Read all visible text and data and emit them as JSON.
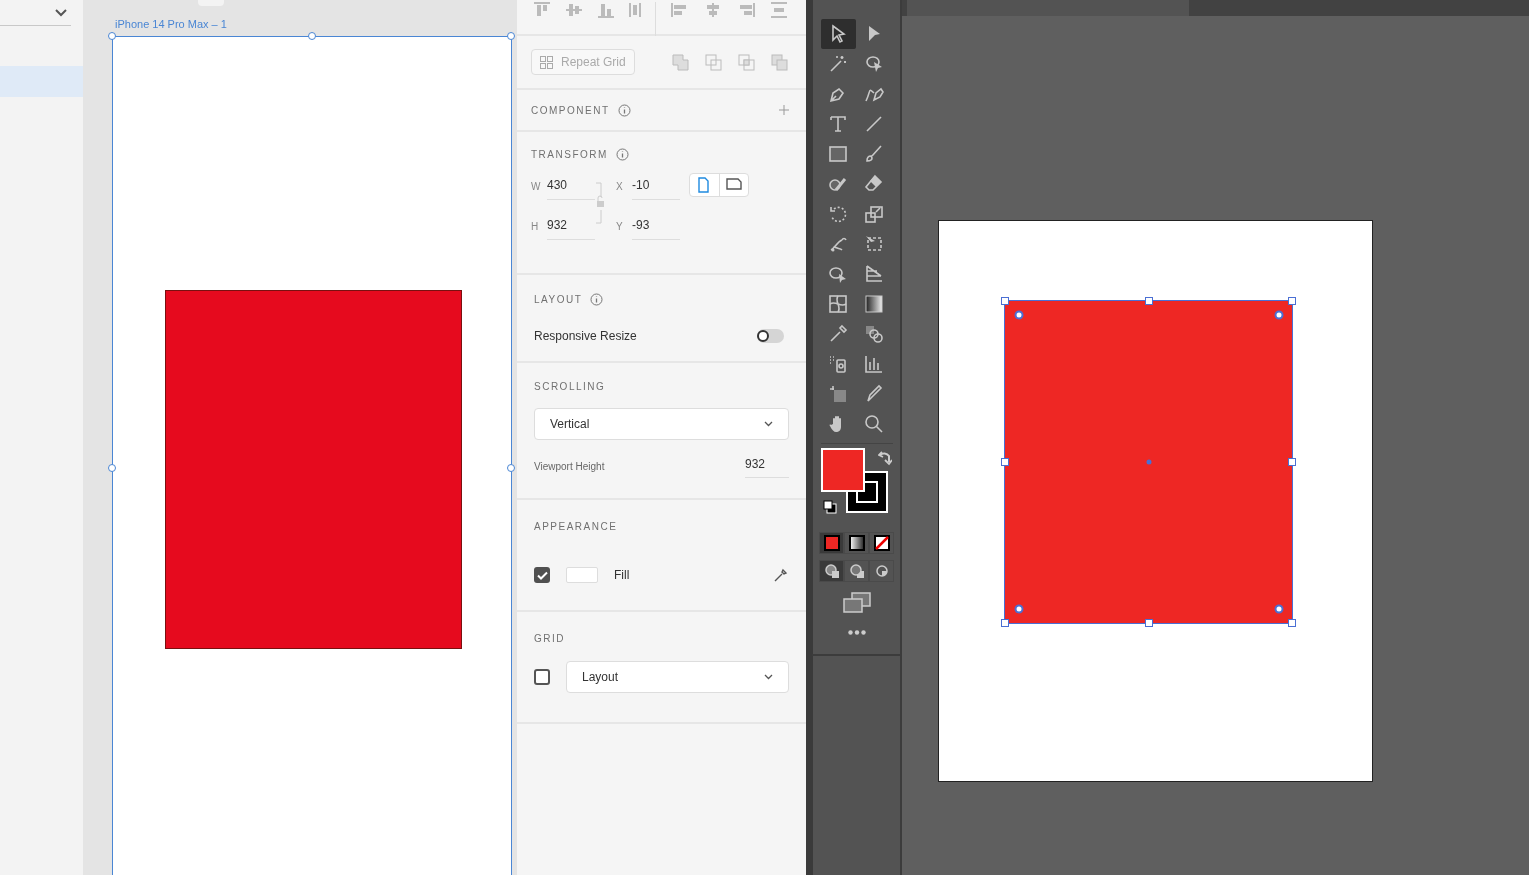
{
  "sidebar": {
    "rows": [
      {
        "selected": true
      }
    ]
  },
  "artboard": {
    "label": "iPhone 14 Pro Max – 1"
  },
  "properties": {
    "repeat_grid": {
      "label": "Repeat Grid"
    },
    "component": {
      "title": "COMPONENT"
    },
    "transform": {
      "title": "TRANSFORM",
      "fields": [
        {
          "label": "W",
          "value": "430"
        },
        {
          "label": "X",
          "value": "-10"
        },
        {
          "label": "H",
          "value": "932"
        },
        {
          "label": "Y",
          "value": "-93"
        }
      ],
      "orientation": [
        {
          "kind": "portrait",
          "selected": true
        },
        {
          "kind": "landscape",
          "selected": false
        }
      ]
    },
    "layout": {
      "title": "LAYOUT",
      "responsive_resize": {
        "label": "Responsive Resize",
        "on": false
      }
    },
    "scrolling": {
      "title": "SCROLLING",
      "mode": "Vertical",
      "viewport_height": {
        "label": "Viewport Height",
        "value": "932"
      }
    },
    "appearance": {
      "title": "APPEARANCE",
      "fill": {
        "label": "Fill",
        "checked": true
      }
    },
    "grid": {
      "title": "GRID",
      "checked": false,
      "type": "Layout"
    }
  },
  "toolbar": {
    "tools": [
      {
        "kind": "selection",
        "selected": true
      },
      {
        "kind": "direct-selection",
        "selected": false
      },
      {
        "kind": "magic-wand",
        "selected": false
      },
      {
        "kind": "lasso",
        "selected": false
      },
      {
        "kind": "pen",
        "selected": false
      },
      {
        "kind": "curvature",
        "selected": false
      },
      {
        "kind": "type",
        "selected": false
      },
      {
        "kind": "line",
        "selected": false
      },
      {
        "kind": "rectangle",
        "selected": false
      },
      {
        "kind": "paintbrush",
        "selected": false
      },
      {
        "kind": "shaper",
        "selected": false
      },
      {
        "kind": "eraser",
        "selected": false
      },
      {
        "kind": "rotate",
        "selected": false
      },
      {
        "kind": "scale",
        "selected": false
      },
      {
        "kind": "puppet-warp",
        "selected": false
      },
      {
        "kind": "free-transform",
        "selected": false
      },
      {
        "kind": "shape-builder",
        "selected": false
      },
      {
        "kind": "perspective-grid",
        "selected": false
      },
      {
        "kind": "mesh",
        "selected": false
      },
      {
        "kind": "gradient",
        "selected": false
      },
      {
        "kind": "eyedropper",
        "selected": false
      },
      {
        "kind": "blend",
        "selected": false
      },
      {
        "kind": "symbol-sprayer",
        "selected": false
      },
      {
        "kind": "graph",
        "selected": false
      },
      {
        "kind": "artboard",
        "selected": false
      },
      {
        "kind": "slice",
        "selected": false
      },
      {
        "kind": "hand",
        "selected": false
      },
      {
        "kind": "zoom",
        "selected": false
      }
    ],
    "color_modes": [
      {
        "kind": "color",
        "selected": true
      },
      {
        "kind": "gradient",
        "selected": false
      },
      {
        "kind": "none",
        "selected": false
      }
    ],
    "draw_modes": [
      {
        "kind": "normal",
        "selected": true
      },
      {
        "kind": "behind",
        "selected": false
      },
      {
        "kind": "inside",
        "selected": false
      }
    ]
  }
}
